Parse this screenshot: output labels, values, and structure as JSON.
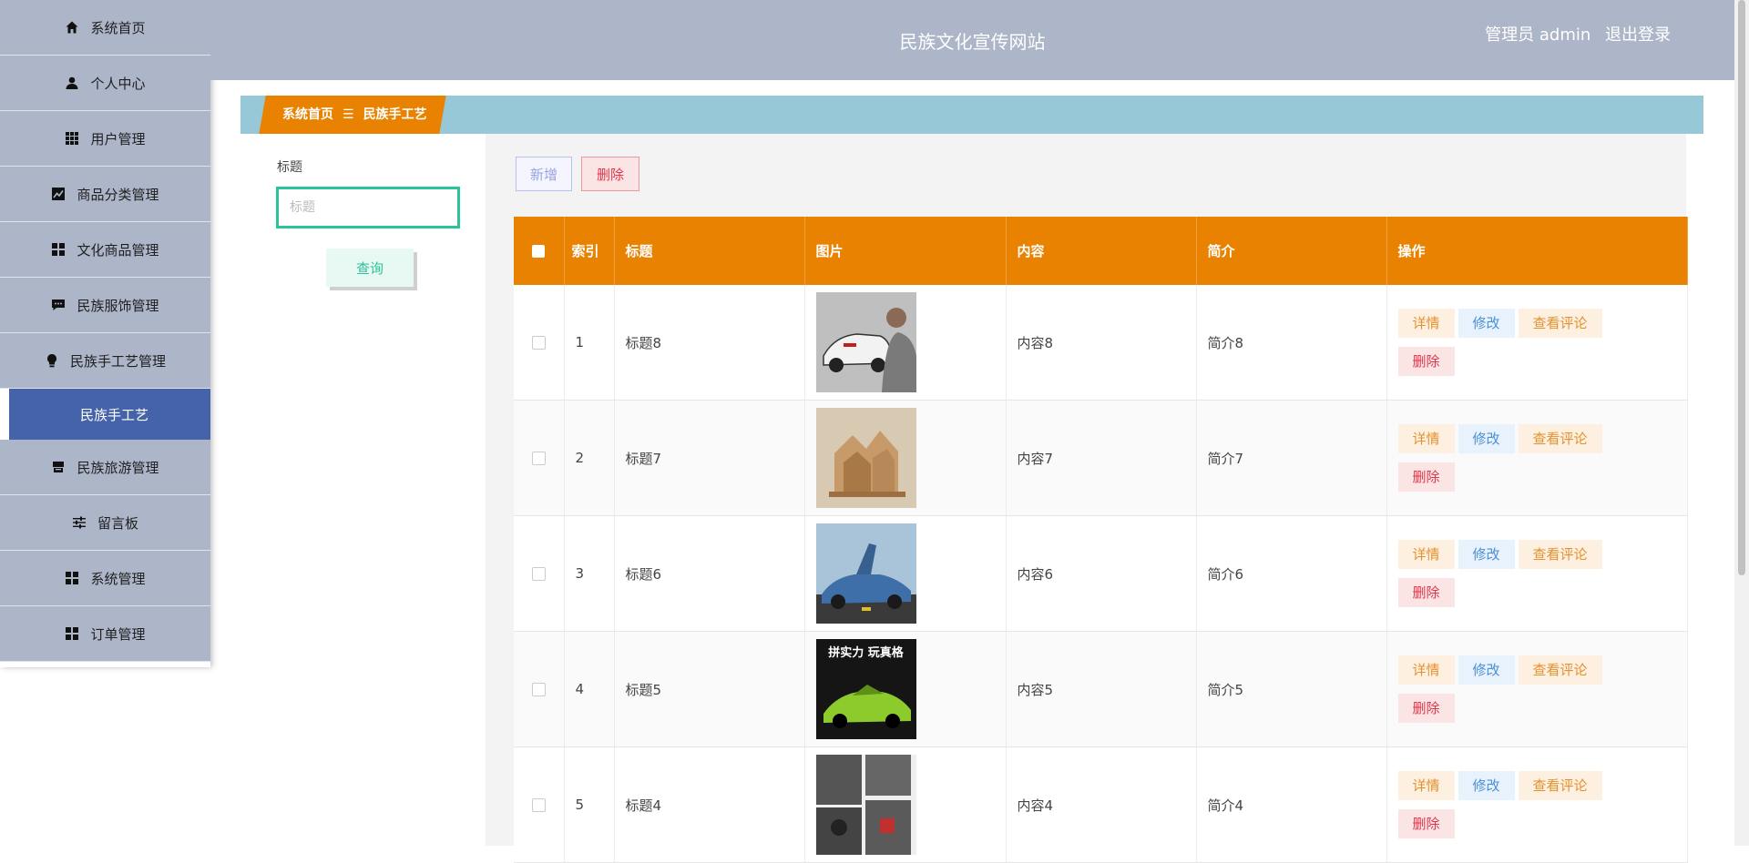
{
  "sidebar": {
    "items": [
      {
        "label": "系统首页",
        "icon": "home-icon"
      },
      {
        "label": "个人中心",
        "icon": "user-icon"
      },
      {
        "label": "用户管理",
        "icon": "grid-icon"
      },
      {
        "label": "商品分类管理",
        "icon": "chart-line-icon"
      },
      {
        "label": "文化商品管理",
        "icon": "apps-icon"
      },
      {
        "label": "民族服饰管理",
        "icon": "comment-icon"
      },
      {
        "label": "民族手工艺管理",
        "icon": "lightbulb-icon"
      },
      {
        "label": "民族旅游管理",
        "icon": "store-icon"
      },
      {
        "label": "留言板",
        "icon": "sliders-icon"
      },
      {
        "label": "系统管理",
        "icon": "apps-icon"
      },
      {
        "label": "订单管理",
        "icon": "apps-icon"
      }
    ],
    "active_sub": "民族手工艺"
  },
  "header": {
    "title": "民族文化宣传网站",
    "user_label": "管理员 admin",
    "logout": "退出登录"
  },
  "breadcrumb": {
    "home": "系统首页",
    "separator": "☰",
    "current": "民族手工艺"
  },
  "search": {
    "label": "标题",
    "placeholder": "标题",
    "value": "",
    "button": "查询"
  },
  "toolbar": {
    "add": "新增",
    "delete": "删除"
  },
  "table": {
    "headers": [
      "索引",
      "标题",
      "图片",
      "内容",
      "简介",
      "操作"
    ],
    "rows": [
      {
        "index": "1",
        "title": "标题8",
        "content": "内容8",
        "intro": "简介8"
      },
      {
        "index": "2",
        "title": "标题7",
        "content": "内容7",
        "intro": "简介7"
      },
      {
        "index": "3",
        "title": "标题6",
        "content": "内容6",
        "intro": "简介6"
      },
      {
        "index": "4",
        "title": "标题5",
        "content": "内容5",
        "intro": "简介5"
      },
      {
        "index": "5",
        "title": "标题4",
        "content": "内容4",
        "intro": "简介4"
      }
    ],
    "actions": {
      "detail": "详情",
      "edit": "修改",
      "comments": "查看评论",
      "delete": "删除"
    },
    "thumb_captions": [
      "",
      "",
      "",
      "拼实力 玩真格",
      ""
    ]
  },
  "colors": {
    "accent_orange": "#e88200",
    "sidebar_bg": "#adb5c9",
    "active_blue": "#4563a8",
    "search_green": "#2ac49a",
    "breadcrumb_bar": "#97c8d7"
  }
}
